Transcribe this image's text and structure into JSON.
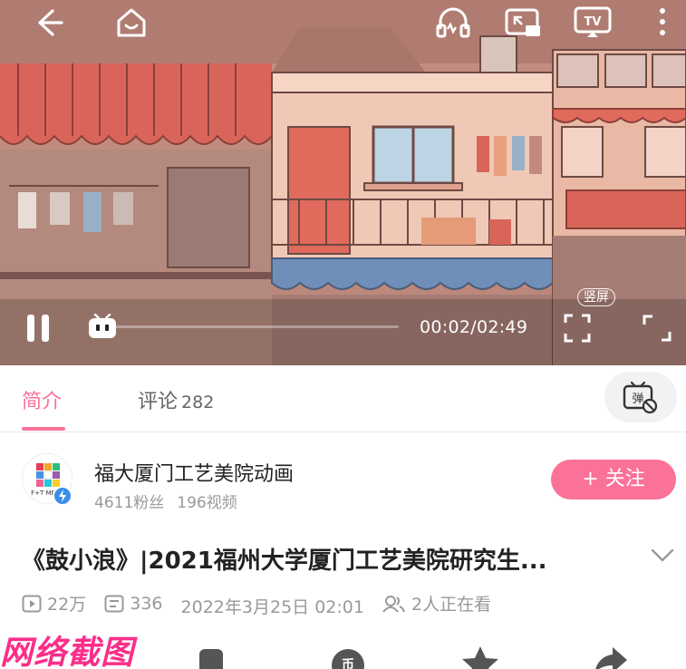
{
  "player": {
    "current_time": "00:02",
    "duration": "02:49",
    "time_display": "00:02/02:49",
    "vertical_badge": "竖屏",
    "progress_fraction": 0.012
  },
  "tabs": [
    {
      "label": "简介",
      "active": true
    },
    {
      "label": "评论",
      "count": "282",
      "active": false
    }
  ],
  "danmaku_button_icon": "danmaku-off-icon",
  "uploader": {
    "name": "福大厦门工艺美院动画",
    "fans": "4611粉丝",
    "videos": "196视频",
    "follow_label": "+ 关注",
    "avatar_text": "F+T MESIS"
  },
  "video": {
    "title": "《鼓小浪》|2021福州大学厦门工艺美院研究生...",
    "views": "22万",
    "danmaku_count": "336",
    "date": "2022年3月25日 02:01",
    "watching": "2人正在看"
  },
  "watermark": "网络截图",
  "colors": {
    "accent": "#fb7299",
    "verified": "#3b8de8"
  }
}
